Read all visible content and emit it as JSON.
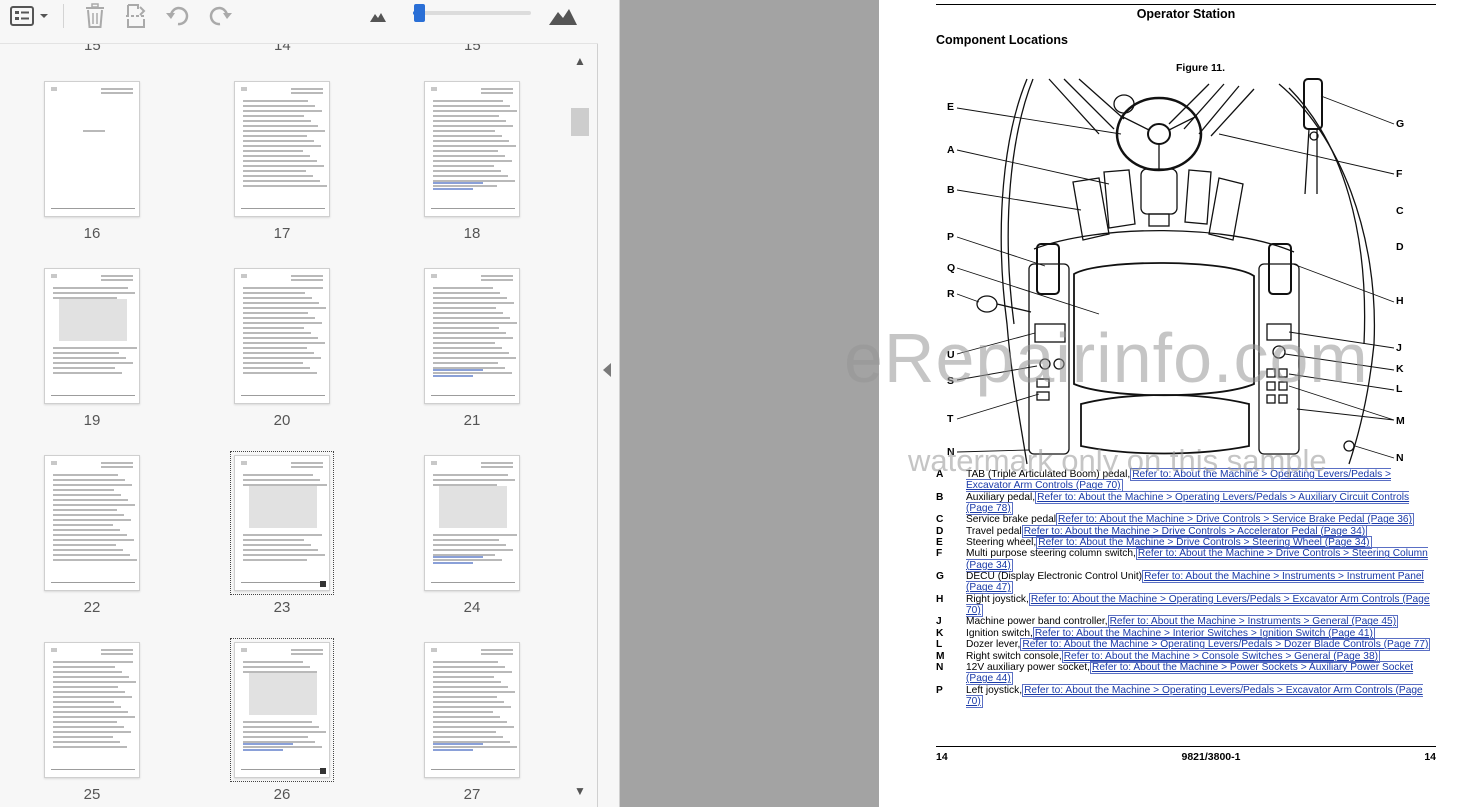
{
  "toolbar": {
    "icons": [
      "thumbnail-view-icon",
      "chevron-down-icon",
      "trash-icon",
      "page-extract-icon",
      "rotate-left-icon",
      "rotate-right-icon",
      "zoom-out-mountain-icon",
      "zoom-in-mountain-icon"
    ],
    "zoom_level": 0.05
  },
  "thumbnails": {
    "previous_row_labels": [
      "15",
      "14",
      "15"
    ],
    "pages": [
      {
        "label": "16"
      },
      {
        "label": "17"
      },
      {
        "label": "18"
      },
      {
        "label": "19"
      },
      {
        "label": "20"
      },
      {
        "label": "21"
      },
      {
        "label": "22"
      },
      {
        "label": "23",
        "selected": true
      },
      {
        "label": "24"
      },
      {
        "label": "25"
      },
      {
        "label": "26",
        "selected": true
      },
      {
        "label": "27"
      }
    ]
  },
  "document": {
    "header": "Operator Station",
    "section_title": "Component Locations",
    "figure_label": "Figure 11.",
    "callouts_left": [
      "E",
      "A",
      "B",
      "P",
      "Q",
      "R",
      "U",
      "S",
      "T",
      "N"
    ],
    "callouts_right": [
      "G",
      "F",
      "C",
      "D",
      "H",
      "J",
      "K",
      "L",
      "M",
      "N"
    ],
    "legend": [
      {
        "key": "A",
        "text": "TAB (Triple Articulated Boom) pedal,",
        "link": "Refer to: About the Machine > Operating Levers/Pedals > Excavator Arm Controls (Page 70)"
      },
      {
        "key": "B",
        "text": "Auxiliary pedal,",
        "link": "Refer to: About the Machine > Operating Levers/Pedals > Auxiliary Circuit Controls (Page 78)"
      },
      {
        "key": "C",
        "text": "Service brake pedal",
        "link": "Refer to: About the Machine > Drive Controls > Service Brake Pedal (Page 36)"
      },
      {
        "key": "D",
        "text": "Travel pedal",
        "link": "Refer to: About the Machine > Drive Controls > Accelerator Pedal (Page 34)"
      },
      {
        "key": "E",
        "text": "Steering wheel,",
        "link": "Refer to: About the Machine > Drive Controls > Steering Wheel (Page 34)"
      },
      {
        "key": "F",
        "text": "Multi purpose steering column switch,",
        "link": "Refer to: About the Machine > Drive Controls > Steering Column (Page 34)"
      },
      {
        "key": "G",
        "text": "DECU (Display Electronic Control Unit)",
        "link": "Refer to: About the Machine > Instruments > Instrument Panel (Page 47)"
      },
      {
        "key": "H",
        "text": "Right joystick,",
        "link": "Refer to: About the Machine > Operating Levers/Pedals > Excavator Arm Controls (Page 70)"
      },
      {
        "key": "J",
        "text": "Machine power band controller,",
        "link": "Refer to: About the Machine > Instruments > General (Page 45)"
      },
      {
        "key": "K",
        "text": "Ignition switch,",
        "link": "Refer to: About the Machine > Interior Switches > Ignition Switch (Page 41)"
      },
      {
        "key": "L",
        "text": "Dozer lever,",
        "link": "Refer to: About the Machine > Operating Levers/Pedals > Dozer Blade Controls (Page 77)"
      },
      {
        "key": "M",
        "text": "Right switch console,",
        "link": "Refer to: About the Machine > Console Switches > General (Page 38)"
      },
      {
        "key": "N",
        "text": "12V auxiliary power socket,",
        "link": "Refer to: About the Machine > Power Sockets > Auxiliary Power Socket (Page 44)"
      },
      {
        "key": "P",
        "text": "Left joystick,",
        "link": "Refer to: About the Machine > Operating Levers/Pedals > Excavator Arm Controls (Page 70)"
      }
    ],
    "footer": {
      "left": "14",
      "center": "9821/3800-1",
      "right": "14"
    }
  },
  "watermark": {
    "line1": "eRepairinfo.com",
    "line2": "watermark only on this sample"
  },
  "colors": {
    "accent": "#2a6fd6",
    "link": "#1a3aa8",
    "gutter": "#a3a3a3"
  }
}
